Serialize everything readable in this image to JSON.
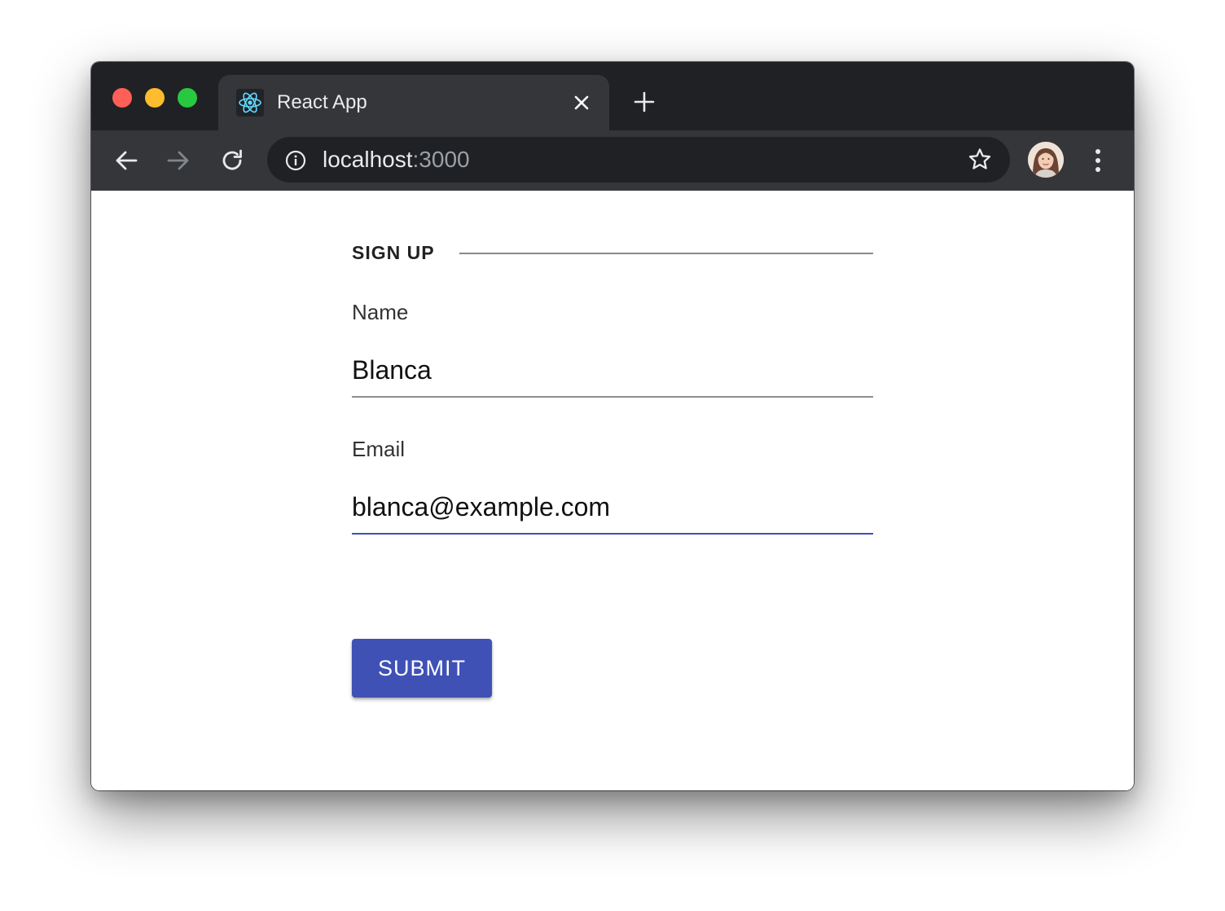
{
  "browser": {
    "tab": {
      "title": "React App",
      "favicon": "react-logo-icon"
    },
    "address": {
      "host": "localhost",
      "port": ":3000"
    },
    "colors": {
      "titlebar": "#202124",
      "tab": "#35363a",
      "toolbar": "#35363a",
      "omnibox": "#202124"
    }
  },
  "form": {
    "section_title": "SIGN UP",
    "fields": [
      {
        "label": "Name",
        "value": "Blanca"
      },
      {
        "label": "Email",
        "value": "blanca@example.com"
      }
    ],
    "submit_label": "SUBMIT",
    "accent_color": "#3f51b5"
  }
}
